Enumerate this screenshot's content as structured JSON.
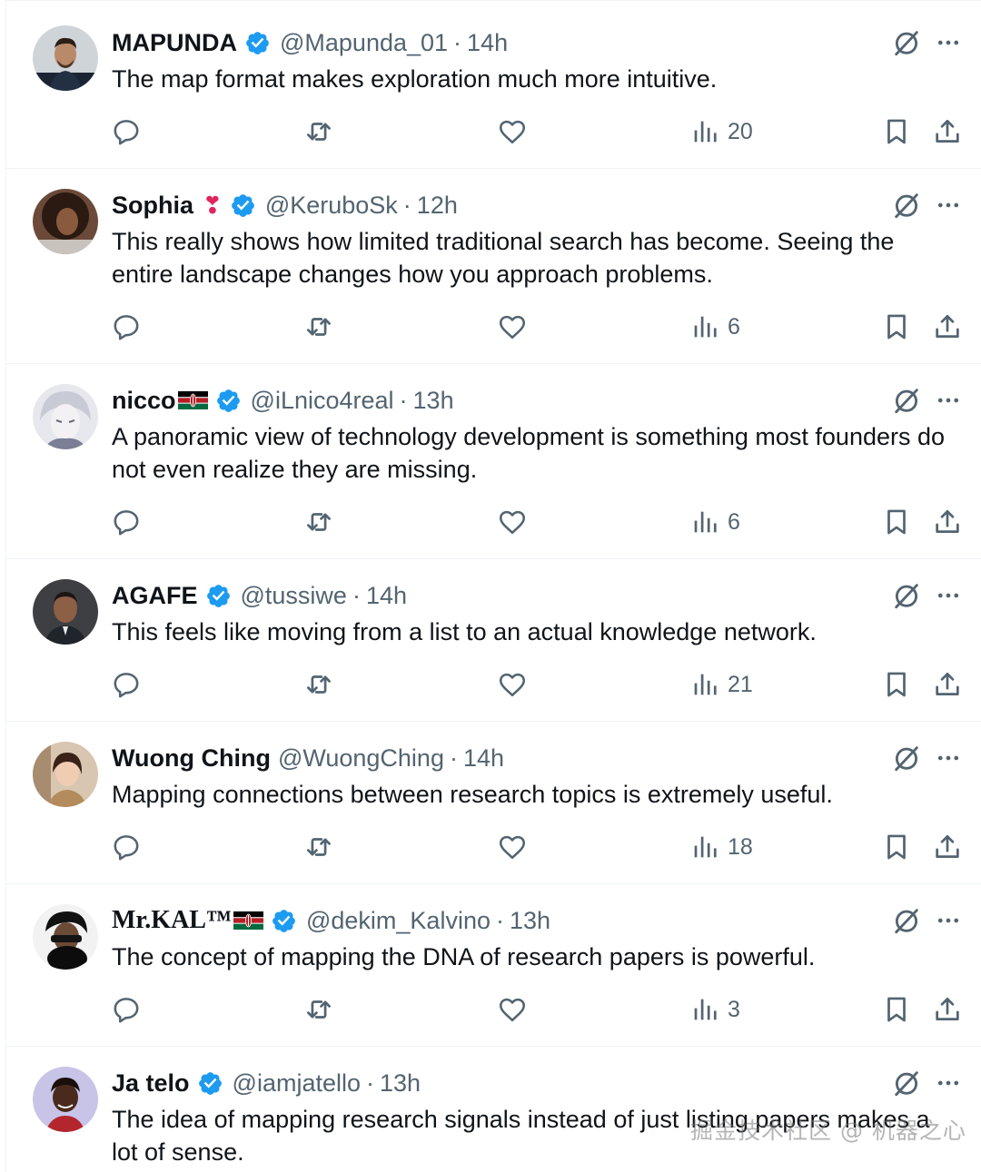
{
  "accent_color": "#1d9bf0",
  "muted_color": "#536471",
  "tweets": [
    {
      "name": "MAPUNDA",
      "verified": true,
      "handle": "@Mapunda_01",
      "separator": "·",
      "time": "14h",
      "text": "The map format makes exploration much more intuitive.",
      "views": "20"
    },
    {
      "name": "Sophia",
      "emoji": "❣",
      "verified": true,
      "handle": "@KeruboSk",
      "separator": "·",
      "time": "12h",
      "text": "This really shows how limited traditional search has become. Seeing the entire landscape changes how you approach problems.",
      "views": "6"
    },
    {
      "name": "nicco",
      "flag": "kenya-flag",
      "verified": true,
      "handle": "@iLnico4real",
      "separator": "·",
      "time": "13h",
      "text": "A panoramic view of technology development is something most founders do not even realize they are missing.",
      "views": "6"
    },
    {
      "name": "AGAFE",
      "verified": true,
      "handle": "@tussiwe",
      "separator": "·",
      "time": "14h",
      "text": "This feels like moving from a list to an actual knowledge network.",
      "views": "21"
    },
    {
      "name": "Wuong Ching",
      "verified": false,
      "handle": "@WuongChing",
      "separator": "·",
      "time": "14h",
      "text": "Mapping connections between research topics is extremely useful.",
      "views": "18"
    },
    {
      "name": "Mr.KAL™",
      "flag": "kenya-flag",
      "verified": true,
      "handle": "@dekim_Kalvino",
      "separator": "·",
      "time": "13h",
      "text": "The concept of mapping the DNA of research papers is powerful.",
      "views": "3"
    },
    {
      "name": "Ja telo",
      "verified": true,
      "handle": "@iamjatello",
      "separator": "·",
      "time": "13h",
      "text": "The idea of mapping research signals instead of just listing papers makes a lot of sense."
    }
  ],
  "watermark": "掘金技术社区 @ 机器之心"
}
